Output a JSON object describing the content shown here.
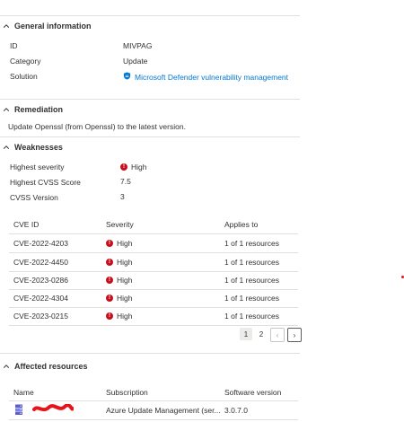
{
  "general": {
    "title": "General information",
    "id_label": "ID",
    "id_value": "MIVPAG",
    "category_label": "Category",
    "category_value": "Update",
    "solution_label": "Solution",
    "solution_value": "Microsoft Defender vulnerability management"
  },
  "remediation": {
    "title": "Remediation",
    "text": "Update Openssl (from Openssl) to the latest version."
  },
  "weaknesses": {
    "title": "Weaknesses",
    "highest_severity_label": "Highest severity",
    "highest_severity_value": "High",
    "highest_cvss_label": "Highest CVSS Score",
    "highest_cvss_value": "7.5",
    "cvss_version_label": "CVSS Version",
    "cvss_version_value": "3",
    "columns": [
      "CVE ID",
      "Severity",
      "Applies to"
    ],
    "rows": [
      {
        "cve": "CVE-2022-4203",
        "severity": "High",
        "applies": "1 of 1 resources"
      },
      {
        "cve": "CVE-2022-4450",
        "severity": "High",
        "applies": "1 of 1 resources"
      },
      {
        "cve": "CVE-2023-0286",
        "severity": "High",
        "applies": "1 of 1 resources"
      },
      {
        "cve": "CVE-2022-4304",
        "severity": "High",
        "applies": "1 of 1 resources"
      },
      {
        "cve": "CVE-2023-0215",
        "severity": "High",
        "applies": "1 of 1 resources"
      }
    ],
    "pagination": {
      "page1": "1",
      "page2": "2",
      "prev": "‹",
      "next": "›"
    }
  },
  "affected": {
    "title": "Affected resources",
    "columns": [
      "Name",
      "Subscription",
      "Software version"
    ],
    "rows": [
      {
        "subscription": "Azure Update Management (ser...",
        "version": "3.0.7.0"
      }
    ]
  },
  "colors": {
    "accent": "#0078d4",
    "danger": "#c50f1f",
    "redaction": "#e8141c"
  },
  "icons": {
    "chevron": "chevron-up-icon",
    "severity": "error-circle-icon",
    "solution": "defender-shield-icon",
    "resource": "server-icon"
  }
}
